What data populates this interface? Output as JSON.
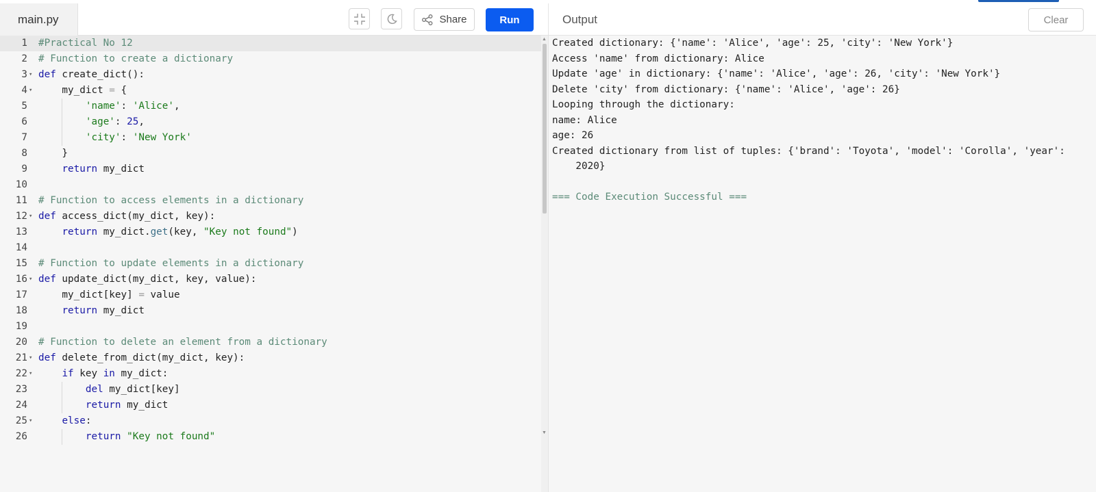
{
  "editor": {
    "file_tab": "main.py",
    "share_label": "Share",
    "run_label": "Run",
    "lines": [
      {
        "n": "1",
        "fold": false,
        "tokens": [
          {
            "t": "#Practical No 12",
            "c": "comment"
          }
        ]
      },
      {
        "n": "2",
        "fold": false,
        "tokens": [
          {
            "t": "# Function to create a dictionary",
            "c": "comment"
          }
        ]
      },
      {
        "n": "3",
        "fold": true,
        "tokens": [
          {
            "t": "def",
            "c": "kw"
          },
          {
            "t": " create_dict():",
            "c": ""
          }
        ]
      },
      {
        "n": "4",
        "fold": true,
        "tokens": [
          {
            "t": "    my_dict ",
            "c": ""
          },
          {
            "t": "=",
            "c": "op"
          },
          {
            "t": " {",
            "c": ""
          }
        ]
      },
      {
        "n": "5",
        "fold": false,
        "tokens": [
          {
            "t": "        ",
            "c": ""
          },
          {
            "t": "'name'",
            "c": "str"
          },
          {
            "t": ": ",
            "c": ""
          },
          {
            "t": "'Alice'",
            "c": "str"
          },
          {
            "t": ",",
            "c": ""
          }
        ]
      },
      {
        "n": "6",
        "fold": false,
        "tokens": [
          {
            "t": "        ",
            "c": ""
          },
          {
            "t": "'age'",
            "c": "str"
          },
          {
            "t": ": ",
            "c": ""
          },
          {
            "t": "25",
            "c": "num"
          },
          {
            "t": ",",
            "c": ""
          }
        ]
      },
      {
        "n": "7",
        "fold": false,
        "tokens": [
          {
            "t": "        ",
            "c": ""
          },
          {
            "t": "'city'",
            "c": "str"
          },
          {
            "t": ": ",
            "c": ""
          },
          {
            "t": "'New York'",
            "c": "str"
          }
        ]
      },
      {
        "n": "8",
        "fold": false,
        "tokens": [
          {
            "t": "    }",
            "c": ""
          }
        ]
      },
      {
        "n": "9",
        "fold": false,
        "tokens": [
          {
            "t": "    ",
            "c": ""
          },
          {
            "t": "return",
            "c": "kw"
          },
          {
            "t": " my_dict",
            "c": ""
          }
        ]
      },
      {
        "n": "10",
        "fold": false,
        "tokens": []
      },
      {
        "n": "11",
        "fold": false,
        "tokens": [
          {
            "t": "# Function to access elements in a dictionary",
            "c": "comment"
          }
        ]
      },
      {
        "n": "12",
        "fold": true,
        "tokens": [
          {
            "t": "def",
            "c": "kw"
          },
          {
            "t": " access_dict(my_dict, key):",
            "c": ""
          }
        ]
      },
      {
        "n": "13",
        "fold": false,
        "tokens": [
          {
            "t": "    ",
            "c": ""
          },
          {
            "t": "return",
            "c": "kw"
          },
          {
            "t": " my_dict.",
            "c": ""
          },
          {
            "t": "get",
            "c": "call"
          },
          {
            "t": "(key, ",
            "c": ""
          },
          {
            "t": "\"Key not found\"",
            "c": "str"
          },
          {
            "t": ")",
            "c": ""
          }
        ]
      },
      {
        "n": "14",
        "fold": false,
        "tokens": []
      },
      {
        "n": "15",
        "fold": false,
        "tokens": [
          {
            "t": "# Function to update elements in a dictionary",
            "c": "comment"
          }
        ]
      },
      {
        "n": "16",
        "fold": true,
        "tokens": [
          {
            "t": "def",
            "c": "kw"
          },
          {
            "t": " update_dict(my_dict, key, value):",
            "c": ""
          }
        ]
      },
      {
        "n": "17",
        "fold": false,
        "tokens": [
          {
            "t": "    my_dict[key] ",
            "c": ""
          },
          {
            "t": "=",
            "c": "op"
          },
          {
            "t": " value",
            "c": ""
          }
        ]
      },
      {
        "n": "18",
        "fold": false,
        "tokens": [
          {
            "t": "    ",
            "c": ""
          },
          {
            "t": "return",
            "c": "kw"
          },
          {
            "t": " my_dict",
            "c": ""
          }
        ]
      },
      {
        "n": "19",
        "fold": false,
        "tokens": []
      },
      {
        "n": "20",
        "fold": false,
        "tokens": [
          {
            "t": "# Function to delete an element from a dictionary",
            "c": "comment"
          }
        ]
      },
      {
        "n": "21",
        "fold": true,
        "tokens": [
          {
            "t": "def",
            "c": "kw"
          },
          {
            "t": " delete_from_dict(my_dict, key):",
            "c": ""
          }
        ]
      },
      {
        "n": "22",
        "fold": true,
        "tokens": [
          {
            "t": "    ",
            "c": ""
          },
          {
            "t": "if",
            "c": "kw"
          },
          {
            "t": " key ",
            "c": ""
          },
          {
            "t": "in",
            "c": "kw"
          },
          {
            "t": " my_dict:",
            "c": ""
          }
        ]
      },
      {
        "n": "23",
        "fold": false,
        "tokens": [
          {
            "t": "        ",
            "c": ""
          },
          {
            "t": "del",
            "c": "kw"
          },
          {
            "t": " my_dict[key]",
            "c": ""
          }
        ]
      },
      {
        "n": "24",
        "fold": false,
        "tokens": [
          {
            "t": "        ",
            "c": ""
          },
          {
            "t": "return",
            "c": "kw"
          },
          {
            "t": " my_dict",
            "c": ""
          }
        ]
      },
      {
        "n": "25",
        "fold": true,
        "tokens": [
          {
            "t": "    ",
            "c": ""
          },
          {
            "t": "else",
            "c": "kw"
          },
          {
            "t": ":",
            "c": ""
          }
        ]
      },
      {
        "n": "26",
        "fold": false,
        "tokens": [
          {
            "t": "        ",
            "c": ""
          },
          {
            "t": "return",
            "c": "kw"
          },
          {
            "t": " ",
            "c": ""
          },
          {
            "t": "\"Key not found\"",
            "c": "str"
          }
        ]
      }
    ]
  },
  "output": {
    "title": "Output",
    "clear_label": "Clear",
    "lines": [
      {
        "text": "Created dictionary: {'name': 'Alice', 'age': 25, 'city': 'New York'}",
        "kind": "normal"
      },
      {
        "text": "Access 'name' from dictionary: Alice",
        "kind": "normal"
      },
      {
        "text": "Update 'age' in dictionary: {'name': 'Alice', 'age': 26, 'city': 'New York'}",
        "kind": "normal"
      },
      {
        "text": "Delete 'city' from dictionary: {'name': 'Alice', 'age': 26}",
        "kind": "normal"
      },
      {
        "text": "Looping through the dictionary:",
        "kind": "normal"
      },
      {
        "text": "name: Alice",
        "kind": "normal"
      },
      {
        "text": "age: 26",
        "kind": "normal"
      },
      {
        "text": "Created dictionary from list of tuples: {'brand': 'Toyota', 'model': 'Corolla', 'year':",
        "kind": "normal"
      },
      {
        "text": "    2020}",
        "kind": "normal"
      },
      {
        "text": "",
        "kind": "normal"
      },
      {
        "text": "=== Code Execution Successful ===",
        "kind": "success"
      }
    ]
  },
  "icons": {
    "fullscreen": "compress-icon",
    "theme": "moon-icon",
    "share": "share-icon",
    "fold": "chevron-down-icon"
  },
  "colors": {
    "run_button": "#0b5cf0",
    "keyword": "#1a1aa6",
    "string": "#1b7a1b",
    "comment": "#5b8a77"
  }
}
